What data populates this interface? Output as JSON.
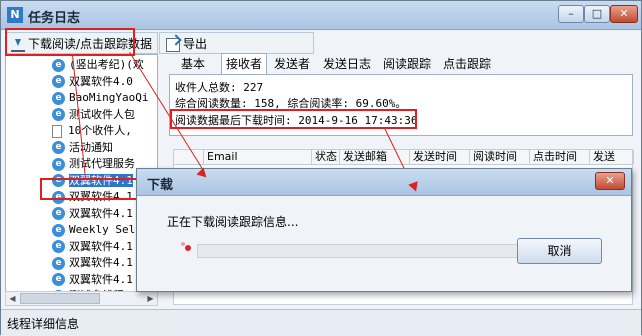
{
  "window": {
    "title": "任务日志",
    "app_icon": "N",
    "minimize_glyph": "–",
    "maximize_glyph": "□",
    "close_glyph": "✕"
  },
  "toolbar": {
    "download_label": "下载阅读/点击跟踪数据",
    "export_label": "导出"
  },
  "tree": {
    "items": [
      {
        "label": "(竖出考纪)(欢",
        "icon": "ie"
      },
      {
        "label": "双翼软件4.0",
        "icon": "ie"
      },
      {
        "label": "BaoMingYaoQi",
        "icon": "ie"
      },
      {
        "label": "测试收件人包",
        "icon": "ie"
      },
      {
        "label": "10个收件人,",
        "icon": "doc"
      },
      {
        "label": "活动通知",
        "icon": "ie"
      },
      {
        "label": "测试代理服务",
        "icon": "ie"
      },
      {
        "label": "双翼软件4.1",
        "icon": "ie",
        "selected": true
      },
      {
        "label": "双翼软件4.1",
        "icon": "ie"
      },
      {
        "label": "双翼软件4.1",
        "icon": "ie"
      },
      {
        "label": "Weekly Sele",
        "icon": "ie"
      },
      {
        "label": "双翼软件4.1",
        "icon": "ie"
      },
      {
        "label": "双翼软件4.1",
        "icon": "ie"
      },
      {
        "label": "双翼软件4.1",
        "icon": "ie"
      },
      {
        "label": "测试多线程",
        "icon": "ie"
      }
    ]
  },
  "tabs": [
    "基本",
    "接收者",
    "发送者",
    "发送日志",
    "阅读跟踪",
    "点击跟踪"
  ],
  "active_tab": 1,
  "info": {
    "total_recipients": "收件人总数: 227",
    "read_summary": "综合阅读数量: 158, 综合阅读率: 69.60%。",
    "last_download": "阅读数据最后下载时间: 2014-9-16 17:43:36"
  },
  "grid": {
    "columns": [
      "",
      "Email",
      "状态",
      "发送邮箱",
      "发送时间",
      "阅读时间",
      "点击时间",
      "发送"
    ]
  },
  "status_bar": {
    "text": "线程详细信息"
  },
  "dialog": {
    "title": "下载",
    "message": "正在下载阅读跟踪信息...",
    "cancel_label": "取消",
    "close_glyph": "✕"
  },
  "colors": {
    "annotation": "#e02020",
    "selection": "#3074c9"
  }
}
